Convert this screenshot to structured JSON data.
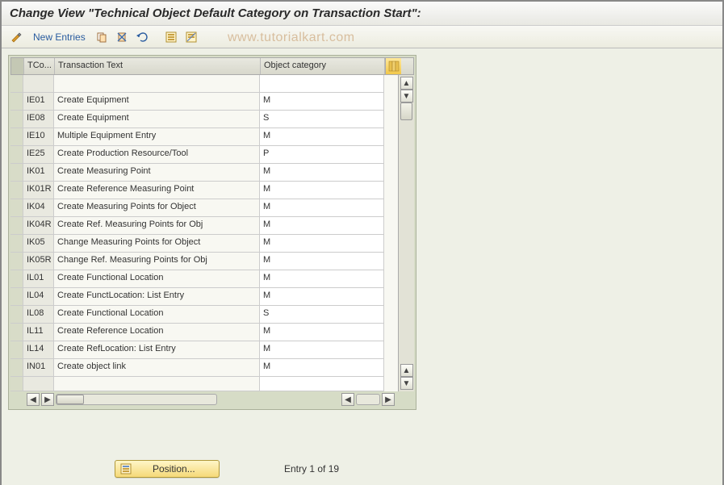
{
  "title": "Change View \"Technical Object Default Category on Transaction Start\":",
  "toolbar": {
    "new_entries_label": "New Entries"
  },
  "watermark": "www.tutorialkart.com",
  "grid": {
    "columns": {
      "tcode": "TCo...",
      "ttext": "Transaction Text",
      "category": "Object category"
    },
    "rows": [
      {
        "tcode": "IE01",
        "ttext": "Create Equipment",
        "category": "M"
      },
      {
        "tcode": "IE08",
        "ttext": "Create Equipment",
        "category": "S"
      },
      {
        "tcode": "IE10",
        "ttext": "Multiple Equipment Entry",
        "category": "M"
      },
      {
        "tcode": "IE25",
        "ttext": "Create Production Resource/Tool",
        "category": "P"
      },
      {
        "tcode": "IK01",
        "ttext": "Create Measuring Point",
        "category": "M"
      },
      {
        "tcode": "IK01R",
        "ttext": "Create Reference Measuring Point",
        "category": "M"
      },
      {
        "tcode": "IK04",
        "ttext": "Create Measuring Points for Object",
        "category": "M"
      },
      {
        "tcode": "IK04R",
        "ttext": "Create Ref. Measuring Points for Obj",
        "category": "M"
      },
      {
        "tcode": "IK05",
        "ttext": "Change Measuring Points for Object",
        "category": "M"
      },
      {
        "tcode": "IK05R",
        "ttext": "Change Ref. Measuring Points for Obj",
        "category": "M"
      },
      {
        "tcode": "IL01",
        "ttext": "Create Functional Location",
        "category": "M"
      },
      {
        "tcode": "IL04",
        "ttext": "Create FunctLocation: List Entry",
        "category": "M"
      },
      {
        "tcode": "IL08",
        "ttext": "Create Functional Location",
        "category": "S"
      },
      {
        "tcode": "IL11",
        "ttext": "Create Reference Location",
        "category": "M"
      },
      {
        "tcode": "IL14",
        "ttext": "Create RefLocation: List Entry",
        "category": "M"
      },
      {
        "tcode": "IN01",
        "ttext": "Create object link",
        "category": "M"
      }
    ]
  },
  "footer": {
    "position_label": "Position...",
    "entry_text": "Entry 1 of 19"
  }
}
